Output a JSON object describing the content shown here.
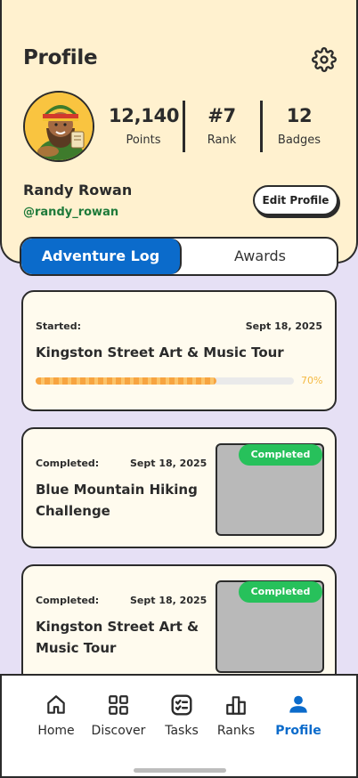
{
  "header": {
    "title": "Profile",
    "settings_icon": "gear-icon"
  },
  "stats": {
    "points": {
      "value": "12,140",
      "label": "Points"
    },
    "rank": {
      "value": "#7",
      "label": "Rank"
    },
    "badges": {
      "value": "12",
      "label": "Badges"
    }
  },
  "user": {
    "name": "Randy Rowan",
    "handle": "@randy_rowan",
    "edit_label": "Edit Profile"
  },
  "tabs": [
    {
      "label": "Adventure Log",
      "active": true
    },
    {
      "label": "Awards",
      "active": false
    }
  ],
  "log": [
    {
      "status_label": "Started:",
      "date": "Sept 18, 2025",
      "title": "Kingston Street Art & Music Tour",
      "progress": 0.7,
      "progress_text": "70%"
    },
    {
      "status_label": "Completed:",
      "date": "Sept 18, 2025",
      "title_line1": "Blue Mountain Hiking",
      "title_line2": "Challenge",
      "badge": "Completed"
    },
    {
      "status_label": "Completed:",
      "date": "Sept 18, 2025",
      "title_line1": "Kingston Street Art &",
      "title_line2": "Music Tour",
      "badge": "Completed"
    }
  ],
  "nav": [
    {
      "label": "Home",
      "icon": "home-icon"
    },
    {
      "label": "Discover",
      "icon": "grid-icon"
    },
    {
      "label": "Tasks",
      "icon": "tasks-icon"
    },
    {
      "label": "Ranks",
      "icon": "ranks-icon"
    },
    {
      "label": "Profile",
      "icon": "person-icon",
      "active": true
    }
  ],
  "colors": {
    "accent": "#0B6BCB",
    "header_bg": "#FFF1CF",
    "page_bg": "#E6E0F5",
    "completed": "#27C15B",
    "progress": "#F7A440"
  }
}
